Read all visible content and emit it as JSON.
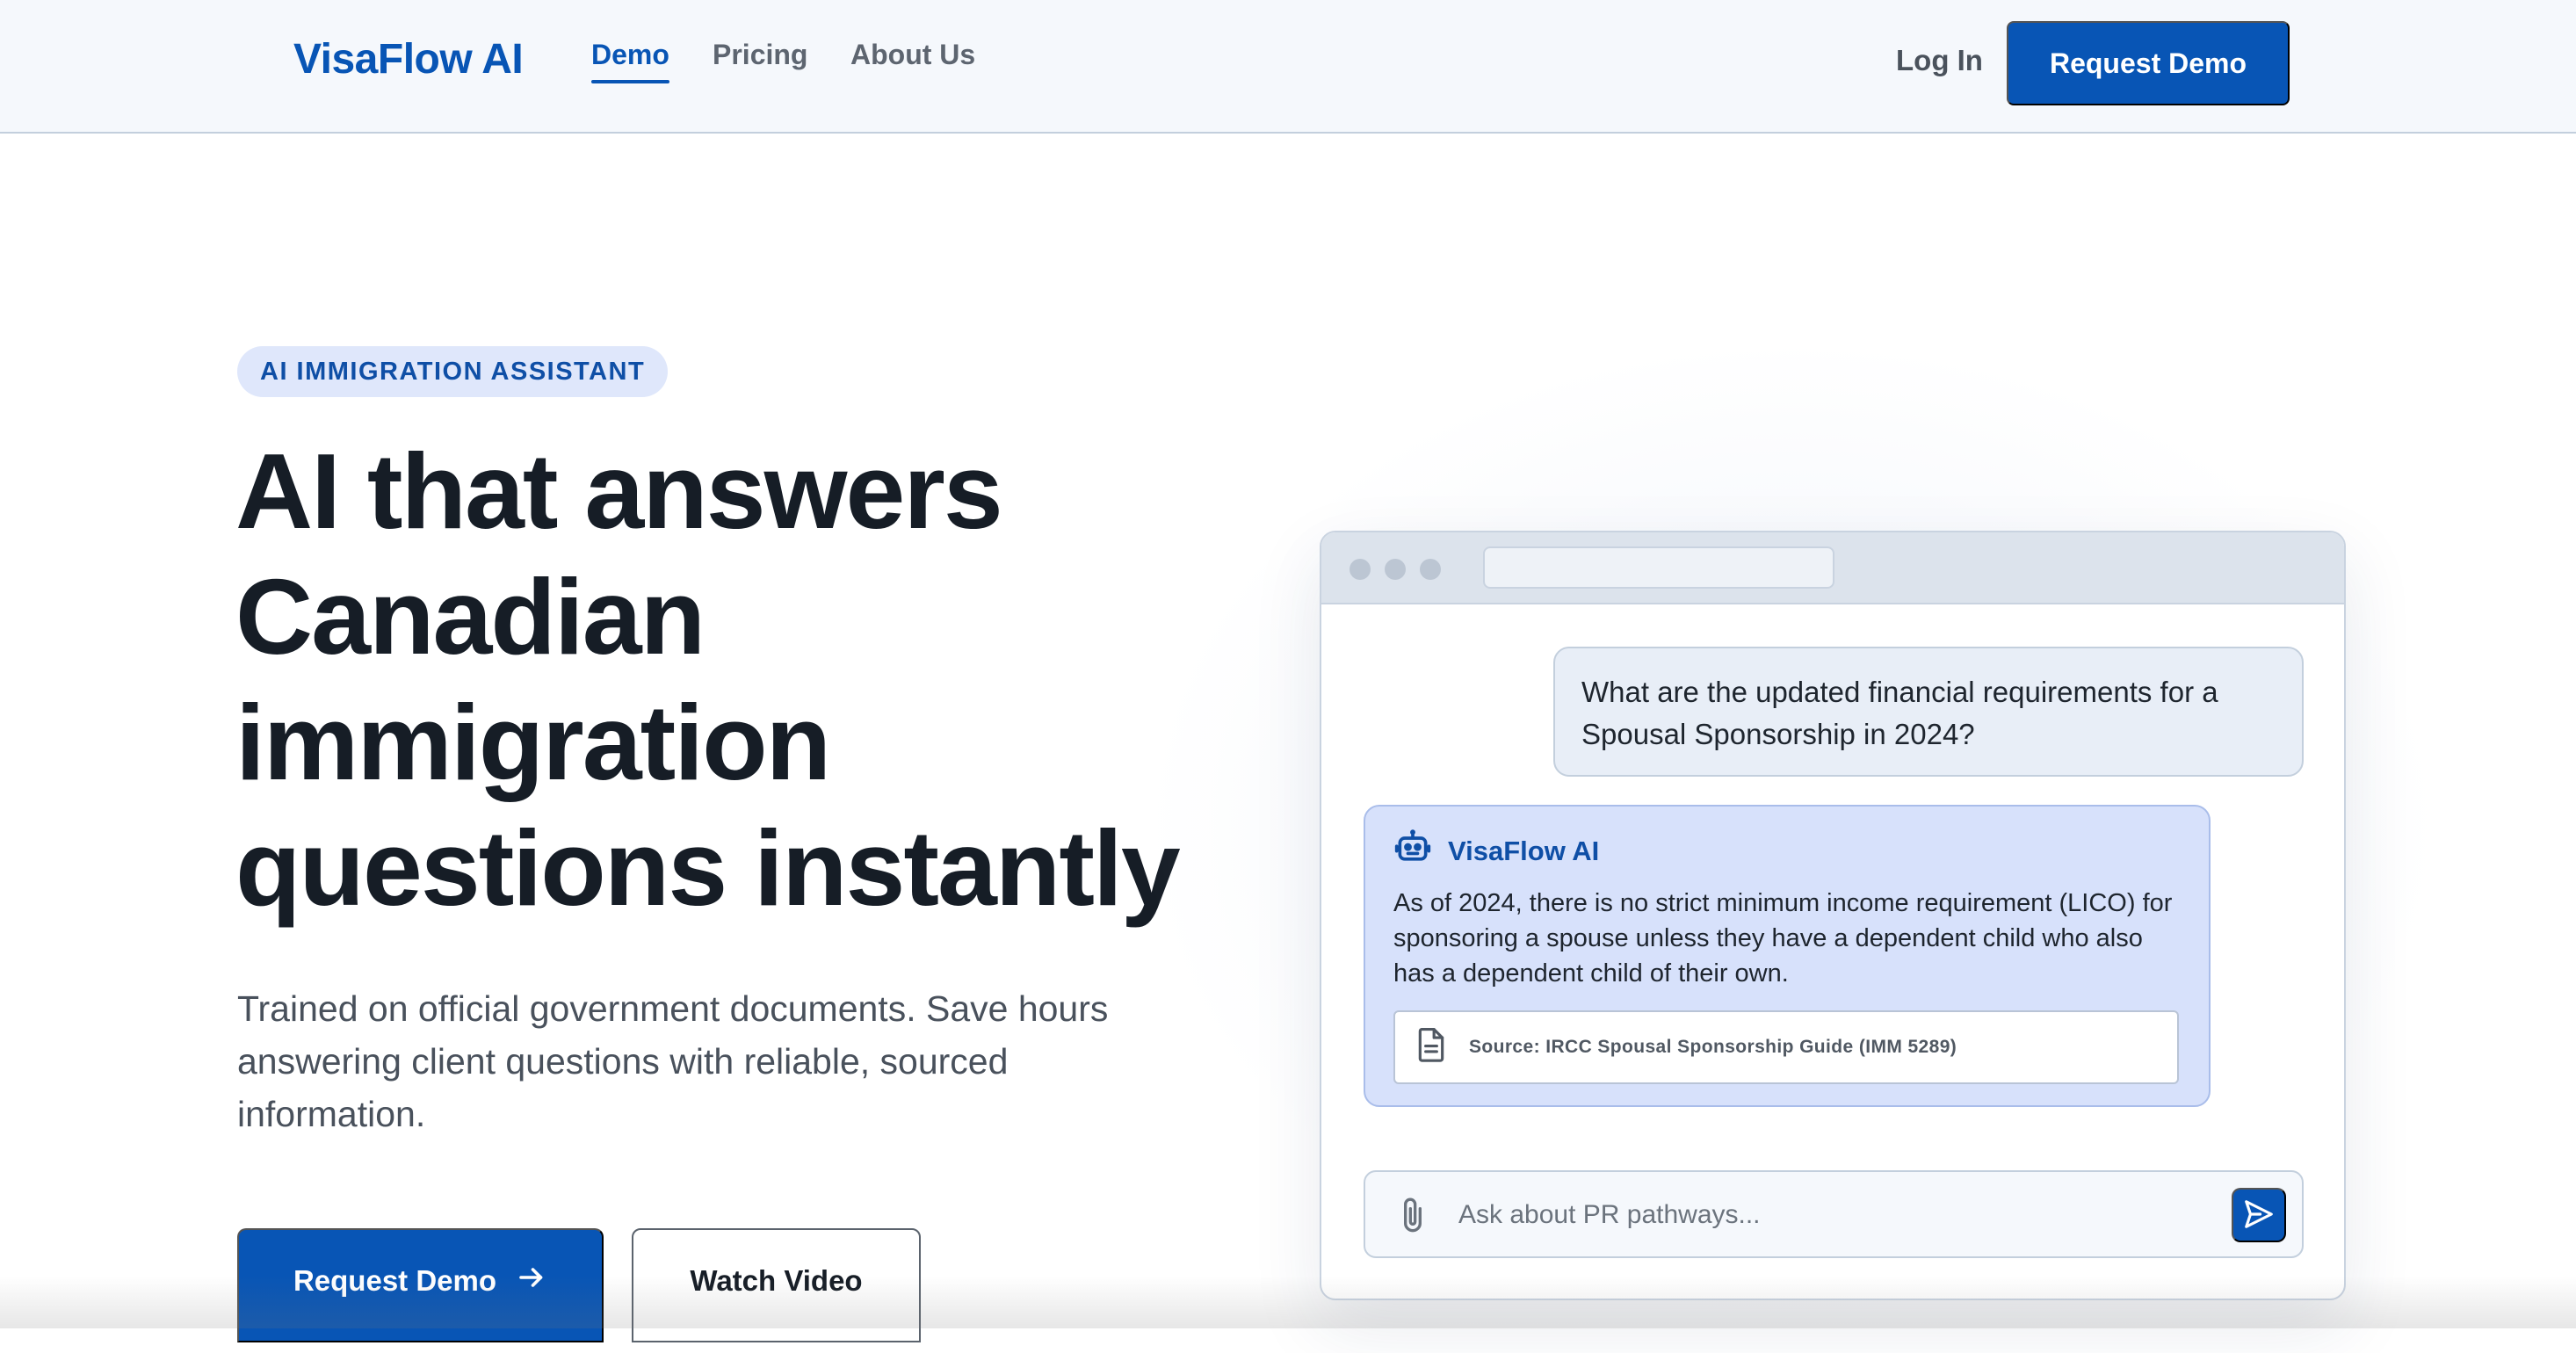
{
  "nav": {
    "logo": "VisaFlow AI",
    "links": [
      {
        "label": "Demo",
        "active": true
      },
      {
        "label": "Pricing",
        "active": false
      },
      {
        "label": "About Us",
        "active": false
      }
    ],
    "login": "Log In",
    "cta": "Request Demo"
  },
  "hero": {
    "badge": "AI IMMIGRATION ASSISTANT",
    "headline_lines": [
      "AI that answers",
      "Canadian",
      "immigration",
      "questions instantly"
    ],
    "subtext": "Trained on official government documents. Save hours answering client questions with reliable, sourced information.",
    "primary_button": "Request Demo",
    "primary_button_icon": "arrow-right-icon",
    "secondary_button": "Watch Video"
  },
  "chat": {
    "user_message": "What are the updated financial requirements for a Spousal Sponsorship in 2024?",
    "ai_name": "VisaFlow AI",
    "ai_icon": "robot-icon",
    "ai_message": "As of 2024, there is no strict minimum income requirement (LICO) for sponsoring a spouse unless they have a dependent child who also has a dependent child of their own.",
    "source_icon": "document-icon",
    "source": "Source: IRCC Spousal Sponsorship Guide (IMM 5289)",
    "input_placeholder": "Ask about PR pathways...",
    "input_value": "",
    "attach_icon": "paperclip-icon",
    "send_icon": "send-icon"
  },
  "colors": {
    "brand": "#0855b5",
    "badge_bg": "#dfe7fb",
    "ai_bubble": "#d7e1fb",
    "user_bubble": "#e8eef7",
    "headline": "#161d26"
  }
}
